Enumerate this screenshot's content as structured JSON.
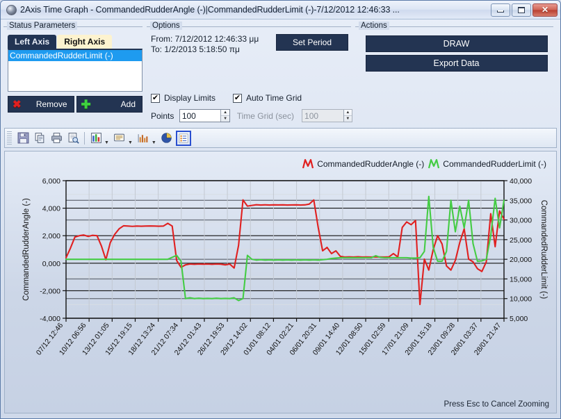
{
  "window": {
    "title": "2Axis Time Graph - CommandedRudderAngle (-)|CommandedRudderLimit (-)-7/12/2012 12:46:33 ...",
    "icon": "app-icon",
    "minimize_label": "Minimize",
    "maximize_label": "Maximize",
    "close_label": "Close"
  },
  "status_parameters": {
    "group_title": "Status Parameters",
    "tabs": [
      {
        "label": "Left Axis",
        "active": false
      },
      {
        "label": "Right Axis",
        "active": true
      }
    ],
    "items": [
      "CommandedRudderLimit (-)"
    ],
    "remove_label": "Remove",
    "add_label": "Add",
    "remove_icon": "cross-icon",
    "add_icon": "plus-icon"
  },
  "options": {
    "group_title": "Options",
    "from_label": "From: 7/12/2012 12:46:33 μμ",
    "to_label": "To: 1/2/2013 5:18:50 πμ",
    "set_period_label": "Set Period",
    "display_limits_label": "Display Limits",
    "display_limits_checked": true,
    "auto_time_grid_label": "Auto Time Grid",
    "auto_time_grid_checked": true,
    "points_label": "Points",
    "points_value": "100",
    "time_grid_label": "Time Grid (sec)",
    "time_grid_value": "100",
    "time_grid_enabled": false,
    "checkmark": "✔"
  },
  "actions": {
    "group_title": "Actions",
    "draw_label": "DRAW",
    "export_label": "Export Data"
  },
  "toolbar": {
    "items": [
      {
        "name": "save-icon",
        "tooltip": "Save"
      },
      {
        "name": "copy-icon",
        "tooltip": "Copy"
      },
      {
        "name": "print-icon",
        "tooltip": "Print"
      },
      {
        "name": "print-preview-icon",
        "tooltip": "Print Preview"
      },
      {
        "name": "chart-type-icon",
        "tooltip": "Chart Type"
      },
      {
        "name": "page-setup-icon",
        "tooltip": "Page Setup"
      },
      {
        "name": "series-icon",
        "tooltip": "Series"
      },
      {
        "name": "pie-chart-icon",
        "tooltip": "Pie Chart"
      },
      {
        "name": "legend-icon",
        "tooltip": "Legend",
        "selected": true
      }
    ]
  },
  "chart_data": {
    "type": "line",
    "title": "",
    "xlabel": "",
    "grid": true,
    "legend_position": "top-right",
    "categories": [
      "07/12 12:46",
      "10/12 06:56",
      "13/12 01:05",
      "15/12 19:15",
      "18/12 13:24",
      "21/12 07:34",
      "24/12 01:43",
      "26/12 19:53",
      "29/12 14:02",
      "01/01 08:12",
      "04/01 02:21",
      "06/01 20:31",
      "09/01 14:40",
      "12/01 08:50",
      "15/01 02:59",
      "17/01 21:09",
      "20/01 15:18",
      "23/01 09:28",
      "26/01 03:37",
      "28/01 21:47"
    ],
    "axes": {
      "left": {
        "label": "CommandedRudderAngle (-)",
        "ticks": [
          "-4,000",
          "-2,000",
          "0,000",
          "2,000",
          "4,000",
          "6,000"
        ],
        "ylim": [
          -4000,
          6000
        ],
        "color": "#cc2222"
      },
      "right": {
        "label": "CommandedRudderLimit (-)",
        "ticks": [
          "5,000",
          "10,000",
          "15,000",
          "20,000",
          "25,000",
          "30,000",
          "35,000",
          "40,000"
        ],
        "ylim": [
          5000,
          40000
        ],
        "color": "#44cc44"
      }
    },
    "series": [
      {
        "name": "CommandedRudderAngle (-)",
        "axis": "left",
        "color": "#e02020",
        "values": [
          400,
          1100,
          1900,
          2000,
          2050,
          1950,
          2030,
          2000,
          1250,
          250,
          1500,
          2100,
          2500,
          2720,
          2700,
          2680,
          2700,
          2690,
          2700,
          2710,
          2700,
          2690,
          2700,
          2900,
          2700,
          200,
          -300,
          -120,
          -60,
          -80,
          -60,
          -70,
          -60,
          -80,
          -60,
          -70,
          -120,
          -60,
          -350,
          1300,
          4600,
          4150,
          4200,
          4250,
          4230,
          4240,
          4230,
          4240,
          4235,
          4240,
          4230,
          4235,
          4240,
          4230,
          4240,
          4300,
          4600,
          2600,
          900,
          1150,
          700,
          900,
          500,
          450,
          460,
          450,
          470,
          450,
          455,
          450,
          460,
          455,
          450,
          460,
          700,
          450,
          2600,
          3000,
          2800,
          3100,
          -3000,
          300,
          -500,
          1000,
          2000,
          1400,
          -200,
          -500,
          200,
          1500,
          2500,
          300,
          100,
          -400,
          -600,
          100,
          3600,
          1200,
          3800,
          3200
        ]
      },
      {
        "name": "CommandedRudderLimit (-)",
        "axis": "right",
        "color": "#44cc44",
        "values": [
          20000,
          20000,
          20000,
          20000,
          20000,
          20000,
          20000,
          20000,
          20000,
          20000,
          20000,
          20000,
          20000,
          20000,
          20000,
          20000,
          20000,
          20000,
          20000,
          20000,
          20000,
          20000,
          20000,
          20000,
          20500,
          21000,
          19500,
          10000,
          10200,
          10000,
          10100,
          10000,
          10050,
          10000,
          10100,
          10000,
          10050,
          10000,
          10200,
          9500,
          10000,
          21000,
          20000,
          19800,
          19900,
          19800,
          19850,
          19800,
          19850,
          19800,
          19850,
          19800,
          19850,
          19800,
          19850,
          19800,
          19850,
          19800,
          19900,
          20000,
          20200,
          20300,
          20400,
          20400,
          20400,
          20400,
          20400,
          20400,
          20400,
          20400,
          20900,
          20500,
          20400,
          20400,
          20400,
          20400,
          20400,
          20400,
          20300,
          20300,
          20400,
          22000,
          36000,
          23000,
          19500,
          19500,
          22000,
          35000,
          27000,
          33500,
          28000,
          35000,
          24000,
          19500,
          19600,
          20000,
          26000,
          35500,
          28000,
          35000
        ]
      }
    ]
  },
  "statusbar": {
    "hint": "Press Esc to Cancel Zooming"
  }
}
